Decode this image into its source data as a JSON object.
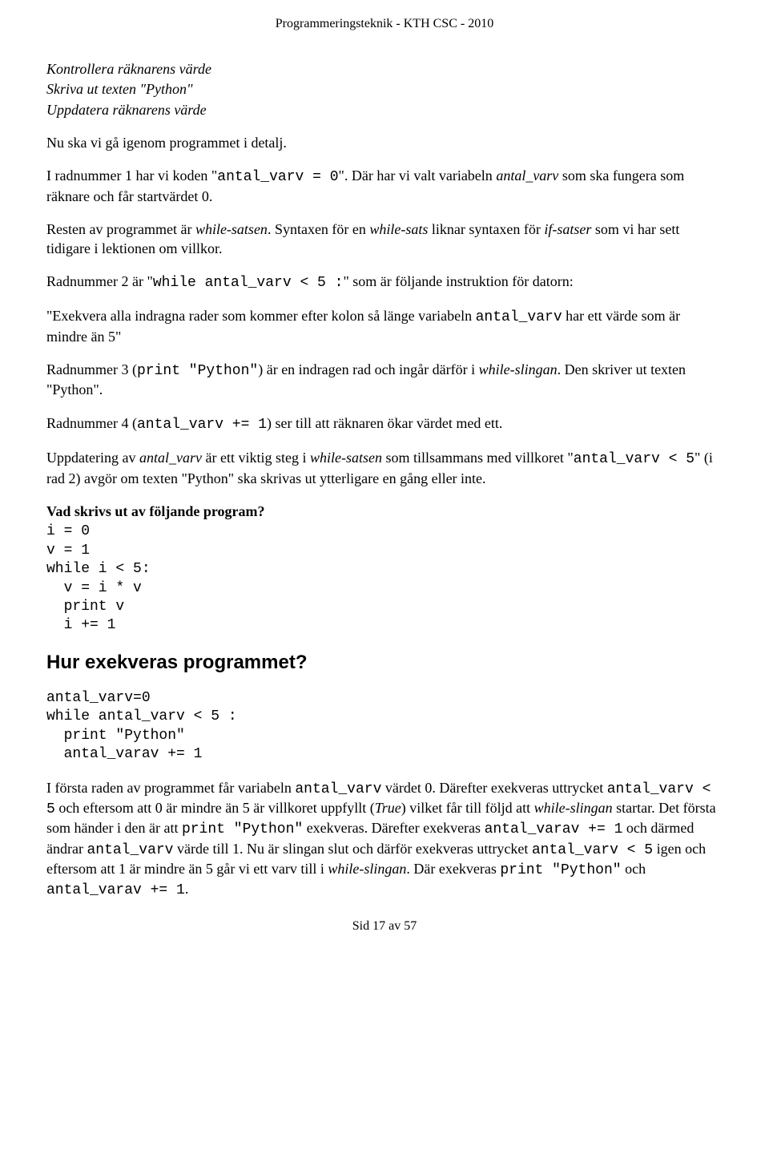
{
  "header": "Programmeringsteknik - KTH CSC - 2010",
  "intro": {
    "line1": "Kontrollera räknarens värde",
    "line2": "Skriva ut texten \"Python\"",
    "line3": "Uppdatera räknarens värde"
  },
  "p1": "Nu ska vi gå igenom programmet i detalj.",
  "p2a": "I radnummer 1 har vi koden \"",
  "p2code": "antal_varv = 0",
  "p2b": "\". Där har vi valt variabeln ",
  "p2ital": "antal_varv",
  "p2c": " som ska fungera som räknare och får startvärdet 0.",
  "p3a": "Resten av programmet är ",
  "p3i1": "while-satsen",
  "p3b": ". Syntaxen för en ",
  "p3i2": "while-sats",
  "p3c": " liknar syntaxen för ",
  "p3i3": "if-satser",
  "p3d": " som vi har sett tidigare i lektionen om villkor.",
  "p4a": "Radnummer 2 är \"",
  "p4code": "while antal_varv < 5 :",
  "p4b": "\" som är följande instruktion för datorn:",
  "p5a": "\"Exekvera alla indragna rader som kommer efter kolon så länge variabeln ",
  "p5code": "antal_varv",
  "p5b": " har ett värde som är mindre än 5\"",
  "p6a": "Radnummer 3 (",
  "p6code": "print \"Python\"",
  "p6b": ") är en indragen rad och ingår därför i ",
  "p6i": "while-slingan",
  "p6c": ". Den skriver ut texten \"Python\".",
  "p7a": "Radnummer 4 (",
  "p7code": "antal_varv += 1",
  "p7b": ") ser till att räknaren ökar värdet med ett.",
  "p8a": "Uppdatering av ",
  "p8i1": "antal_varv",
  "p8b": " är ett viktig steg i ",
  "p8i2": "while-satsen",
  "p8c": " som tillsammans med villkoret \"",
  "p8code": "antal_varv < 5",
  "p8d": "\" (i rad 2) avgör om texten \"Python\" ska skrivas ut ytterligare en gång eller inte.",
  "q1": "Vad skrivs ut av följande program?",
  "code1": "i = 0\nv = 1\nwhile i < 5:\n  v = i * v\n  print v\n  i += 1",
  "h2": "Hur exekveras programmet?",
  "code2": "antal_varv=0\nwhile antal_varv < 5 :\n  print \"Python\"\n  antal_varav += 1",
  "p9a": "I första raden av programmet får variabeln ",
  "p9c1": "antal_varv",
  "p9b": " värdet 0. Därefter exekveras uttrycket ",
  "p9c2": "antal_varv < 5",
  "p9c": " och eftersom att 0 är mindre än 5 är villkoret uppfyllt (",
  "p9i1": "True",
  "p9d": ") vilket får till följd att ",
  "p9i2": "while-slingan",
  "p9e": " startar. Det första som händer i den är att ",
  "p9c3": "print \"Python\"",
  "p9f": " exekveras. Därefter exekveras ",
  "p9c4": "antal_varav += 1",
  "p9g": " och därmed ändrar ",
  "p9c5": "antal_varv",
  "p9h": " värde till 1. Nu är slingan slut och därför exekveras uttrycket ",
  "p9c6": "antal_varv < 5",
  "p9j": " igen och eftersom att 1 är mindre än 5 går vi ett varv till i ",
  "p9i3": "while-slingan",
  "p9k": ". Där exekveras ",
  "p9c7": "print \"Python\"",
  "p9l": " och ",
  "p9c8": "antal_varav += 1",
  "p9m": ".",
  "footer": "Sid 17 av 57"
}
